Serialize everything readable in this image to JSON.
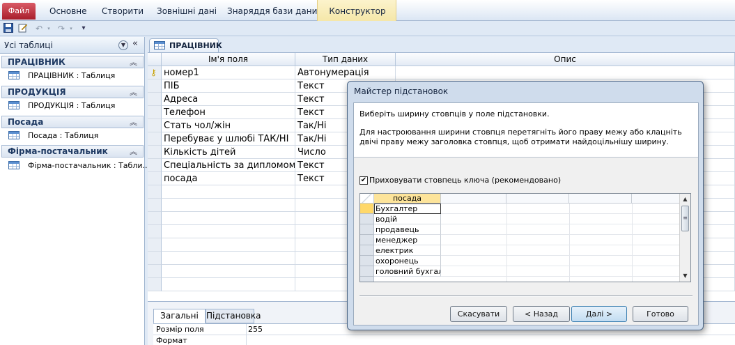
{
  "ribbon": {
    "file_tab": "Файл",
    "tabs": [
      "Основне",
      "Створити",
      "Зовнішні дані",
      "Знаряддя бази даних"
    ],
    "context_tab": "Конструктор"
  },
  "nav": {
    "title": "Усі таблиці",
    "groups": [
      {
        "label": "ПРАЦІВНИК",
        "item": "ПРАЦІВНИК : Таблиця"
      },
      {
        "label": "ПРОДУКЦІЯ",
        "item": "ПРОДУКЦІЯ : Таблиця"
      },
      {
        "label": "Посада",
        "item": "Посада : Таблиця"
      },
      {
        "label": "Фірма-постачальник",
        "item": "Фірма-постачальник : Табли..."
      }
    ]
  },
  "doc_tab": "ПРАЦІВНИК",
  "design_grid": {
    "headers": [
      "Ім'я поля",
      "Тип даних",
      "Опис"
    ],
    "rows": [
      {
        "field": "номер1",
        "type": "Автонумерація",
        "key": true
      },
      {
        "field": "ПІБ",
        "type": "Текст"
      },
      {
        "field": "Адреса",
        "type": "Текст"
      },
      {
        "field": "Телефон",
        "type": "Текст"
      },
      {
        "field": "Стать чол/жін",
        "type": "Так/Ні"
      },
      {
        "field": "Перебуває у шлюбі ТАК/НІ",
        "type": "Так/Ні"
      },
      {
        "field": "Кількість дітей",
        "type": "Число"
      },
      {
        "field": "Спеціальність за дипломом",
        "type": "Текст"
      },
      {
        "field": "посада",
        "type": "Текст"
      }
    ]
  },
  "properties": {
    "tabs": [
      "Загальні",
      "Підстановка"
    ],
    "rows": [
      {
        "label": "Розмір поля",
        "value": "255"
      },
      {
        "label": "Формат",
        "value": ""
      }
    ]
  },
  "dialog": {
    "title": "Майстер підстановок",
    "heading": "Виберіть ширину стовпців у поле підстановки.",
    "description": "Для настроювання ширини стовпця перетягніть його праву межу або клацніть двічі праву межу заголовка стовпця, щоб отримати найдоцільнішу ширину.",
    "checkbox_label": "Приховувати стовпець ключа (рекомендовано)",
    "checkbox_checked": true,
    "column_header": "посада",
    "values": [
      "Бухгалтер",
      "водій",
      "продавець",
      "менеджер",
      "електрик",
      "охоронець",
      "головний бухгалт"
    ],
    "buttons": {
      "cancel": "Скасувати",
      "back": "< Назад",
      "next": "Далі >",
      "finish": "Готово"
    }
  },
  "colors": {
    "accent": "#b8202d",
    "context_tab": "#f7e8a6",
    "selection": "#ffd86a"
  }
}
